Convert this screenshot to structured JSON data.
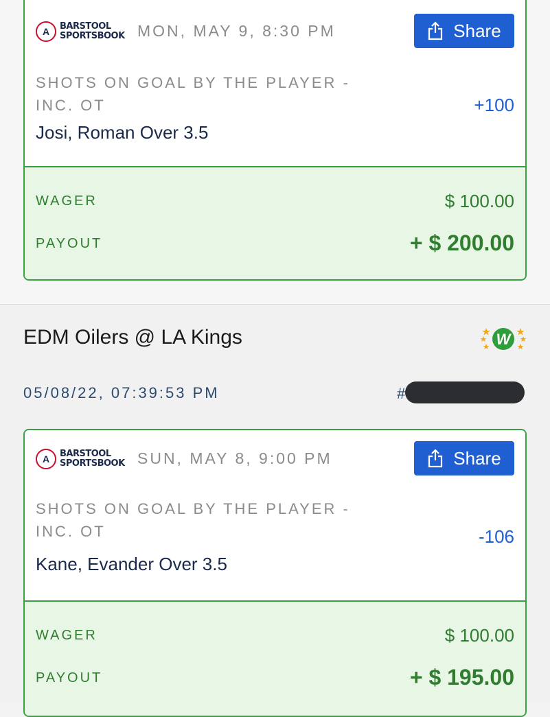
{
  "bet_top": {
    "sportsbook": {
      "line1": "BARSTOOL",
      "line2": "SPORTSBOOK",
      "badge": "A"
    },
    "event_date": "MON, MAY 9, 8:30 PM",
    "share_label": "Share",
    "market": "SHOTS ON GOAL BY THE PLAYER - INC. OT",
    "selection": "Josi, Roman Over 3.5",
    "odds": "+100",
    "wager_label": "WAGER",
    "wager_value": "$ 100.00",
    "payout_label": "PAYOUT",
    "payout_value": "+ $ 200.00"
  },
  "bet_bottom": {
    "game_title": "EDM Oilers @ LA Kings",
    "win_badge": "W",
    "placed_at": "05/08/22, 07:39:53 PM",
    "bet_id_prefix": "#",
    "sportsbook": {
      "line1": "BARSTOOL",
      "line2": "SPORTSBOOK",
      "badge": "A"
    },
    "event_date": "SUN, MAY 8, 9:00 PM",
    "share_label": "Share",
    "market": "SHOTS ON GOAL BY THE PLAYER - INC. OT",
    "selection": "Kane, Evander Over 3.5",
    "odds": "-106",
    "wager_label": "WAGER",
    "wager_value": "$ 100.00",
    "payout_label": "PAYOUT",
    "payout_value": "+ $ 195.00"
  },
  "colors": {
    "win_green": "#3aa043",
    "share_blue": "#1f5fd1",
    "money_bg": "#e8f6e6",
    "money_text": "#2f7d2f",
    "navy_text": "#1b2a4a",
    "win_badge_star": "#f0a81c"
  },
  "icons": {
    "share": "share-icon",
    "win": "win-badge-icon",
    "logo": "barstool-logo-icon"
  }
}
